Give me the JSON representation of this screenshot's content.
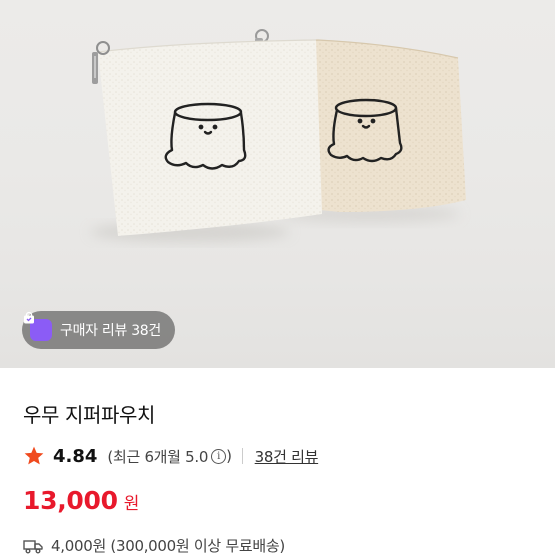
{
  "photo": {
    "review_badge_label": "구매자 리뷰 38건",
    "review_badge_icon": "shopping-bag-icon",
    "badge_color": "#8b5cf6"
  },
  "product": {
    "title": "우무 지퍼파우치",
    "rating_score": "4.84",
    "rating_recent": "(최근 6개월 5.0",
    "rating_recent_close": ")",
    "review_count_link": "38건 리뷰",
    "price_amount": "13,000",
    "price_unit": "원",
    "shipping_text": "4,000원 (300,000원 이상 무료배송)",
    "price_color": "#e8192c",
    "star_color": "#f04a1e"
  }
}
